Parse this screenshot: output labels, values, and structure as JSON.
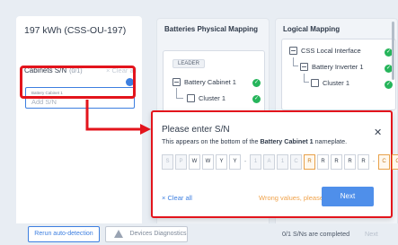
{
  "left": {
    "system_title": "197 kWh (CSS-OU-197)",
    "cabinets_label": "Cabinets S/N",
    "cabinets_count": "(0/1)",
    "clear_all": "× Clear all",
    "sn_field_label": "Battery Cabinet 1",
    "sn_field_placeholder": "Add S/N"
  },
  "batteries_panel": {
    "title": "Batteries Physical Mapping",
    "leader_badge": "LEADER",
    "cabinet": "Battery Cabinet 1",
    "cluster": "Cluster 1"
  },
  "logical_panel": {
    "title": "Logical Mapping",
    "css": "CSS Local Interface",
    "inverter": "Battery Inverter 1",
    "cluster": "Cluster 1"
  },
  "modal": {
    "title": "Please enter S/N",
    "subtitle_pre": "This appears on the bottom of the ",
    "subtitle_bold": "Battery Cabinet 1",
    "subtitle_post": " nameplate.",
    "chars": [
      {
        "v": "S",
        "s": "dim"
      },
      {
        "v": "P",
        "s": "dim"
      },
      {
        "v": "W",
        "s": "filled"
      },
      {
        "v": "W",
        "s": "filled"
      },
      {
        "v": "Y",
        "s": "filled"
      },
      {
        "v": "Y",
        "s": "filled"
      },
      {
        "v": "-",
        "s": "dash"
      },
      {
        "v": "1",
        "s": "dim"
      },
      {
        "v": "A",
        "s": "dim"
      },
      {
        "v": "1",
        "s": "dim"
      },
      {
        "v": "C",
        "s": "dim"
      },
      {
        "v": "R",
        "s": "err"
      },
      {
        "v": "R",
        "s": "filled"
      },
      {
        "v": "R",
        "s": "filled"
      },
      {
        "v": "R",
        "s": "filled"
      },
      {
        "v": "R",
        "s": "filled"
      },
      {
        "v": "-",
        "s": "dash"
      },
      {
        "v": "C",
        "s": "err"
      },
      {
        "v": "C",
        "s": "err"
      }
    ],
    "clear_all": "× Clear all",
    "error": "Wrong values, please fix",
    "next": "Next"
  },
  "footer": {
    "rerun": "Rerun auto-detection",
    "diagnostics": "Devices Diagnostics",
    "completed": "0/1 S/Ns are completed",
    "next": "Next"
  },
  "colors": {
    "accent": "#3d7fe0",
    "highlight": "#e3141c",
    "success": "#26b55b",
    "warning": "#f0a24a"
  }
}
